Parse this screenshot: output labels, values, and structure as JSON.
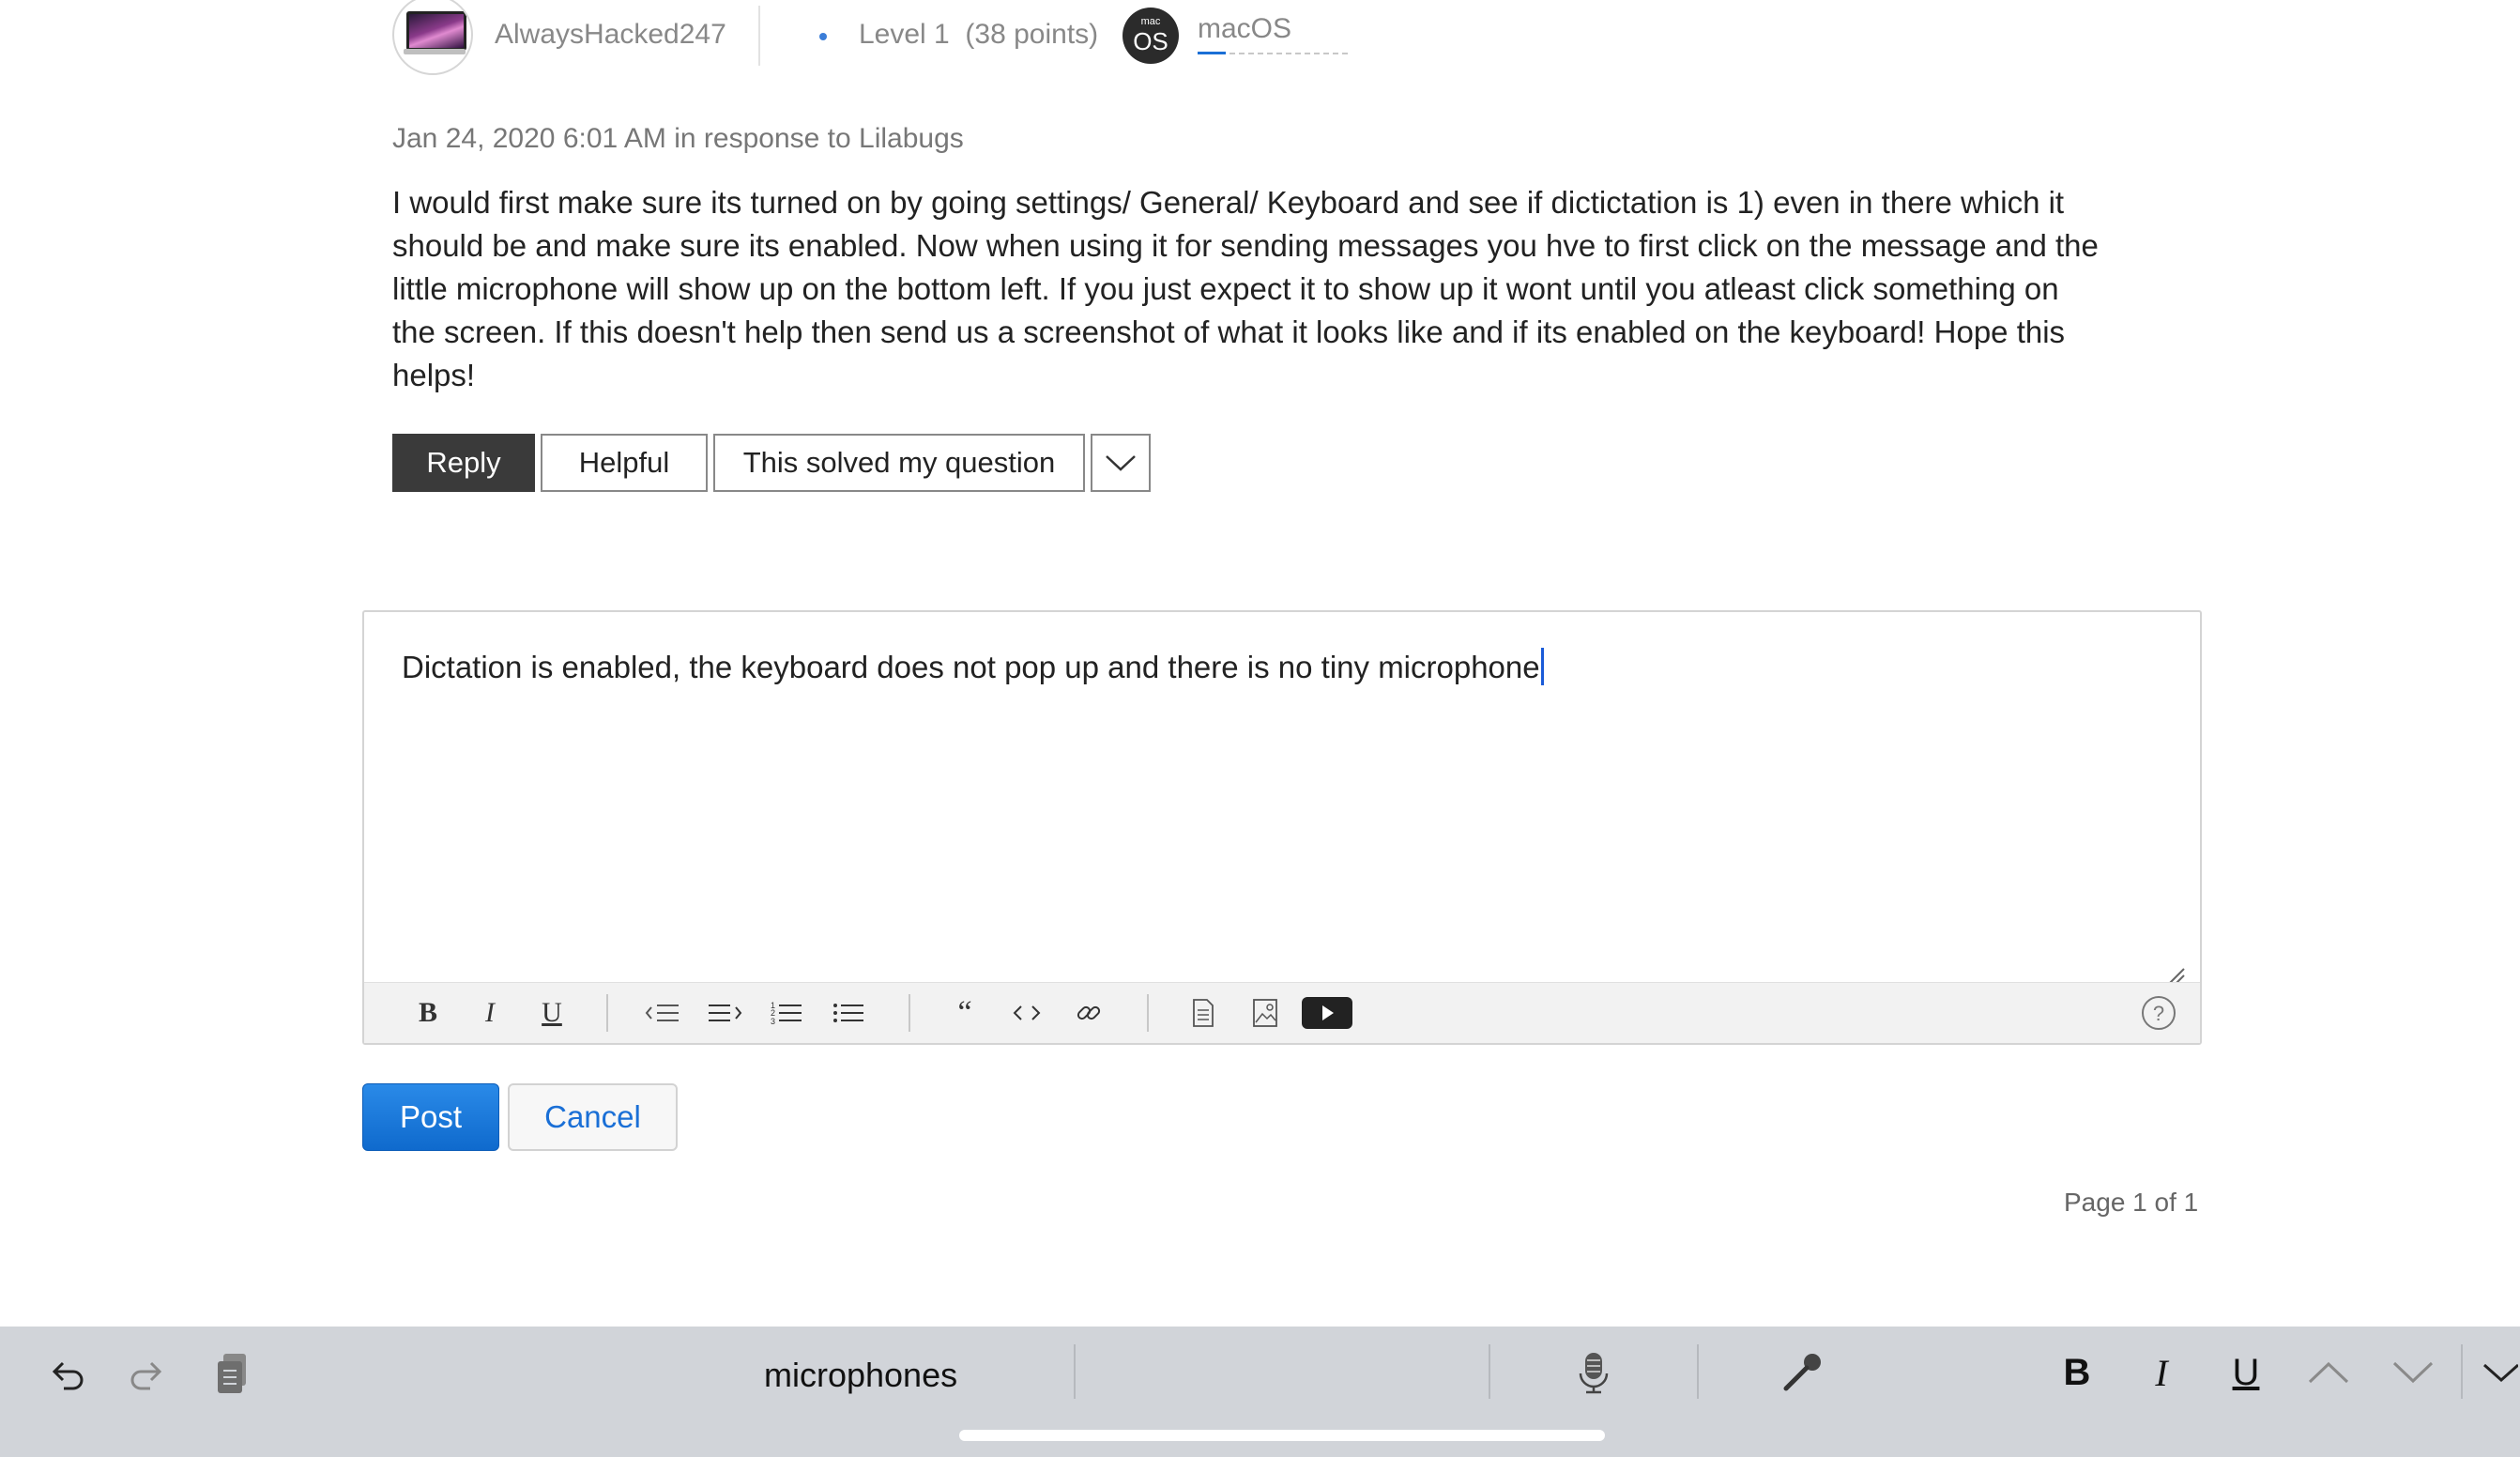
{
  "post": {
    "author": "AlwaysHacked247",
    "level": "Level 1",
    "points": "(38 points)",
    "badge_small": "mac",
    "badge_big": "OS",
    "community": "macOS",
    "meta": "Jan 24, 2020 6:01 AM in response to Lilabugs",
    "body": "I would first make sure its turned on by going settings/ General/ Keyboard and see if dictictation is 1) even in there which it should be and make sure its enabled. Now when using it for sending messages you hve to first click on the message and the little microphone will show up on the bottom left. If you just expect it to show up it wont until you atleast click something on the screen. If this doesn't help then send us a screenshot of what it looks like and if its enabled on the keyboard! Hope this helps!"
  },
  "actions": {
    "reply": "Reply",
    "helpful": "Helpful",
    "solved": "This solved my question"
  },
  "editor": {
    "text": "Dictation is enabled, the keyboard does not pop up and there is no tiny microphone",
    "toolbar": [
      "bold-icon",
      "italic-icon",
      "underline-icon",
      "outdent-icon",
      "indent-icon",
      "numbered-list-icon",
      "bulleted-list-icon",
      "quote-icon",
      "code-icon",
      "link-icon",
      "document-icon",
      "image-icon",
      "video-icon",
      "help-icon"
    ]
  },
  "form": {
    "post": "Post",
    "cancel": "Cancel"
  },
  "pagination": "Page 1 of 1",
  "keyboard_bar": {
    "suggestion": "microphones",
    "icons": [
      "undo-icon",
      "redo-icon",
      "paste-icon",
      "dictation-mic-icon",
      "microphone-icon",
      "bold-icon",
      "italic-icon",
      "underline-icon",
      "chevron-up-icon",
      "chevron-down-icon",
      "dismiss-keyboard-icon"
    ]
  },
  "colors": {
    "accent": "#1a6fd6",
    "reply_button": "#3a3a3a",
    "keyboard_bar": "#d1d4d9"
  }
}
